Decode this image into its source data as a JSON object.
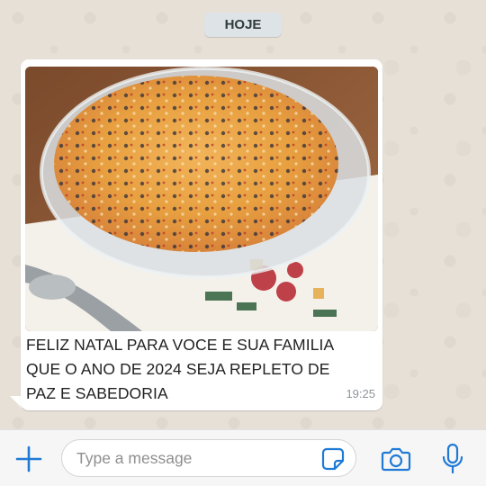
{
  "chat": {
    "date_label": "HOJE",
    "message": {
      "caption_lines": [
        "FELIZ NATAL PARA VOCE E SUA FAMILIA",
        "QUE O ANO DE 2024 SEJA REPLETO DE",
        "PAZ E SABEDORIA"
      ],
      "time": "19:25",
      "image_icon": "food-photo"
    }
  },
  "input_bar": {
    "placeholder": "Type a message",
    "value": "",
    "icons": [
      "plus-icon",
      "sticker-icon",
      "camera-icon",
      "microphone-icon"
    ]
  },
  "colors": {
    "accent": "#1f7ad6",
    "chat_background": "#e7e0d7",
    "bubble": "#ffffff",
    "date_pill": "#dde3e6",
    "timestamp": "#8d959a"
  }
}
